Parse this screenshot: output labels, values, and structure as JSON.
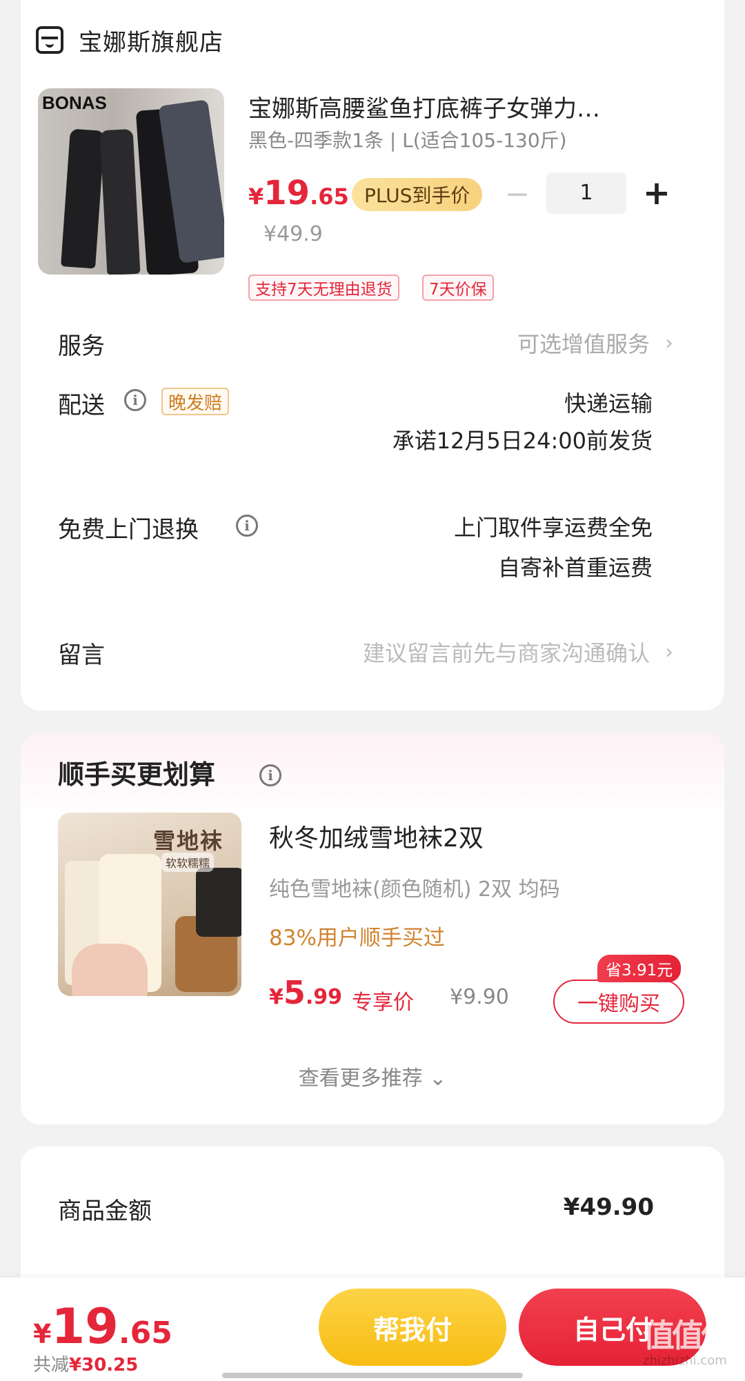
{
  "store": {
    "name": "宝娜斯旗舰店",
    "icon": "store-icon"
  },
  "product": {
    "title": "宝娜斯高腰鲨鱼打底裤子女弹力…",
    "spec": "黑色-四季款1条 | L(适合105-130斤)",
    "thumb_brand": "BONAS",
    "price_symbol": "¥",
    "price_int": "19",
    "price_dec": ".65",
    "plus_label": "PLUS到手价",
    "original_price": "¥49.9",
    "quantity": "1",
    "minus": "−",
    "plus": "+",
    "tags": [
      "支持7天无理由退货",
      "7天价保"
    ]
  },
  "service": {
    "label": "服务",
    "value": "可选增值服务",
    "chevron": "›"
  },
  "delivery": {
    "label": "配送",
    "badge": "晚发赔",
    "method": "快递运输",
    "promise": "承诺12月5日24:00前发货"
  },
  "return": {
    "label": "免费上门退换",
    "line1": "上门取件享运费全免",
    "line2": "自寄补首重运费"
  },
  "message": {
    "label": "留言",
    "placeholder": "建议留言前先与商家沟通确认",
    "chevron": "›"
  },
  "addon": {
    "title": "顺手买更划算",
    "name": "秋冬加绒雪地袜2双",
    "spec": "纯色雪地袜(颜色随机) 2双   均码",
    "social": "83%用户顺手买过",
    "price_symbol": "¥",
    "price_int": "5",
    "price_dec": ".99",
    "exclusive_label": "专享价",
    "original_price": "¥9.90",
    "save_badge": "省3.91元",
    "buy_label": "一键购买",
    "more": "查看更多推荐 ⌄",
    "thumb_label": "雪地袜",
    "thumb_sub": "软软糯糯"
  },
  "summary": {
    "goods_label": "商品金额",
    "goods_value": "¥49.90"
  },
  "bottom": {
    "price_symbol": "¥",
    "price_int": "19",
    "price_dec": ".65",
    "discount_label": "共减",
    "discount_value": "¥30.25",
    "help_pay": "帮我付",
    "self_pay": "自己付",
    "watermark": "值值值",
    "watermark_sub": "zhizhizhi.com"
  },
  "colors": {
    "accent_red": "#e4263b",
    "plus_gold": "#f7d27e",
    "help_yellow": "#f7bd13"
  }
}
